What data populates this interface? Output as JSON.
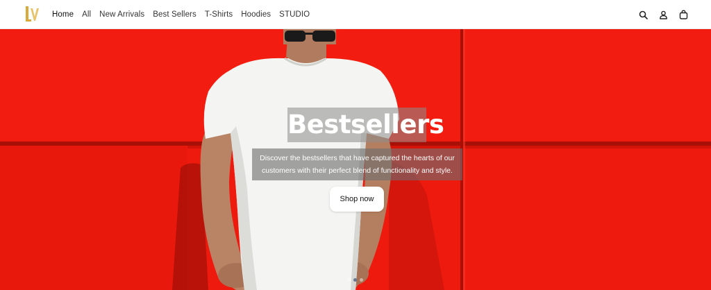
{
  "header": {
    "logo_alt": "LV",
    "nav": [
      {
        "label": "Home",
        "active": true
      },
      {
        "label": "All"
      },
      {
        "label": "New Arrivals"
      },
      {
        "label": "Best Sellers"
      },
      {
        "label": "T-Shirts"
      },
      {
        "label": "Hoodies"
      },
      {
        "label": "STUDIO"
      }
    ],
    "icons": [
      "search-icon",
      "account-icon",
      "cart-icon"
    ]
  },
  "hero": {
    "title": "Bestsellers",
    "subtitle": "Discover the bestsellers that have captured the hearts of our customers with their perfect blend of functionality and style.",
    "cta_label": "Shop now",
    "slides_count": 3,
    "active_slide": 2,
    "background_color": "#ee1a0e"
  },
  "colors": {
    "logo_gold": "#d9a93a",
    "hero_red": "#ee1a0e"
  }
}
